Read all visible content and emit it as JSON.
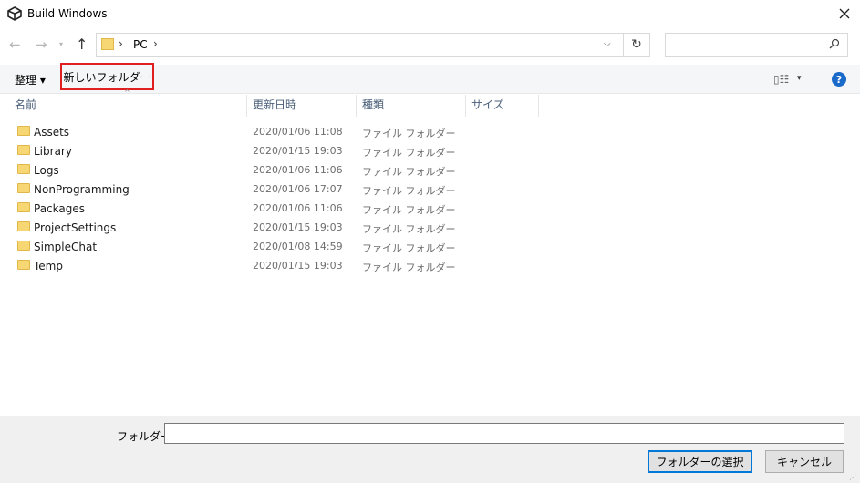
{
  "window": {
    "title": "Build Windows"
  },
  "nav": {
    "back": "←",
    "forward": "→",
    "recent": "▾",
    "up": "↑",
    "address": {
      "sep1": "›",
      "location": "PC",
      "sep2": "›",
      "dropdown": "⌵"
    },
    "refresh": "↻",
    "search_placeholder": ""
  },
  "toolbar": {
    "organize": "整理 ▾",
    "new_folder": "新しいフォルダー",
    "view": "▯☷",
    "view_dropdown": "▾",
    "help": "?"
  },
  "columns": {
    "name": "名前",
    "date": "更新日時",
    "type": "種類",
    "size": "サイズ",
    "sort_indicator": "^"
  },
  "files": [
    {
      "name": "Assets",
      "date": "2020/01/06 11:08",
      "type": "ファイル フォルダー"
    },
    {
      "name": "Library",
      "date": "2020/01/15 19:03",
      "type": "ファイル フォルダー"
    },
    {
      "name": "Logs",
      "date": "2020/01/06 11:06",
      "type": "ファイル フォルダー"
    },
    {
      "name": "NonProgramming",
      "date": "2020/01/06 17:07",
      "type": "ファイル フォルダー"
    },
    {
      "name": "Packages",
      "date": "2020/01/06 11:06",
      "type": "ファイル フォルダー"
    },
    {
      "name": "ProjectSettings",
      "date": "2020/01/15 19:03",
      "type": "ファイル フォルダー"
    },
    {
      "name": "SimpleChat",
      "date": "2020/01/08 14:59",
      "type": "ファイル フォルダー"
    },
    {
      "name": "Temp",
      "date": "2020/01/15 19:03",
      "type": "ファイル フォルダー"
    }
  ],
  "bottom": {
    "folder_label": "フォルダー:",
    "folder_value": "",
    "select_button": "フォルダーの選択",
    "cancel_button": "キャンセル"
  },
  "colors": {
    "highlight_border": "#e02020",
    "accent": "#0078d7",
    "folder": "#f7d774"
  }
}
